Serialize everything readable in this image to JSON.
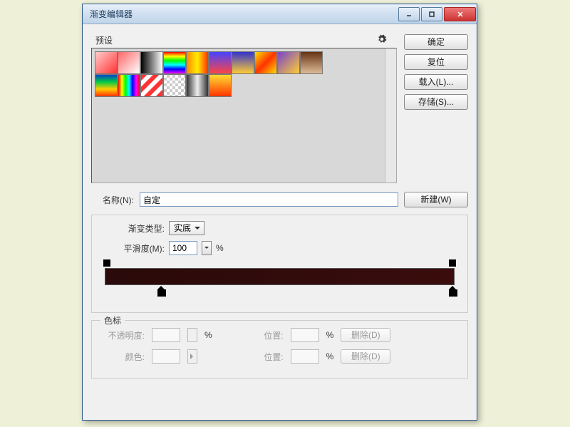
{
  "window": {
    "title": "渐变编辑器"
  },
  "presets": {
    "label": "预设",
    "swatches": [
      {
        "bg": "linear-gradient(135deg,#ffcccc,#ff3333)"
      },
      {
        "bg": "linear-gradient(135deg,#ff6666,#fff)",
        "checker": true
      },
      {
        "bg": "linear-gradient(to right,#000,#fff)"
      },
      {
        "bg": "linear-gradient(to bottom,#ff0000,#ffff00,#00ff00,#00ffff,#0000ff,#ff00ff)"
      },
      {
        "bg": "linear-gradient(to right,#ff8800,#ffee00,#ff3300)"
      },
      {
        "bg": "linear-gradient(to bottom,#4444ff,#ff4444)"
      },
      {
        "bg": "linear-gradient(to bottom,#3333cc,#ffcc33)"
      },
      {
        "bg": "linear-gradient(135deg,#ffdd00,#ff3300,#ffdd00)"
      },
      {
        "bg": "linear-gradient(135deg,#7744cc,#ffcc33)"
      },
      {
        "bg": "linear-gradient(to bottom,#663311,#ddbb99)"
      },
      {
        "bg": "linear-gradient(to bottom,#0044cc,#00cc44,#ffcc00,#ff3300)"
      },
      {
        "bg": "linear-gradient(90deg,#ff0000,#ffff00,#00ff00,#00ffff,#0000ff,#ff00ff,#ff0000)"
      },
      {
        "bg": "repeating-linear-gradient(135deg,#ff3333 0 6px,#fff 6px 12px)"
      },
      {
        "bg": "",
        "checker": true
      },
      {
        "bg": "linear-gradient(to right,#333,#eee,#333)"
      },
      {
        "bg": "linear-gradient(to bottom,#ffdd33,#ff3300)"
      }
    ]
  },
  "buttons": {
    "ok": "确定",
    "reset": "复位",
    "load": "载入(L)...",
    "save": "存储(S)...",
    "new": "新建(W)",
    "delete": "删除(D)"
  },
  "name": {
    "label": "名称(N):",
    "value": "自定"
  },
  "gradientType": {
    "label": "渐变类型:",
    "value": "实底"
  },
  "smoothness": {
    "label": "平滑度(M):",
    "value": "100",
    "unit": "%"
  },
  "stops": {
    "legend": "色标",
    "opacity_label": "不透明度:",
    "color_label": "颜色:",
    "position_label": "位置:",
    "unit": "%"
  },
  "icons": {
    "gear": "gear-icon",
    "dropdown": "chevron-down-icon"
  }
}
